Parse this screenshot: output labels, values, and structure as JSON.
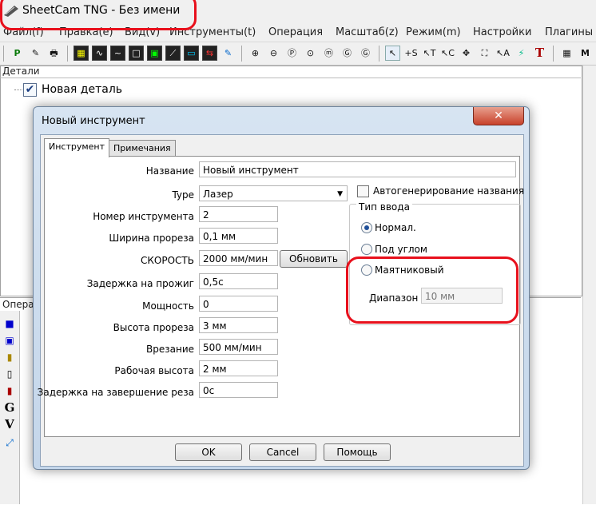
{
  "window": {
    "title": "SheetCam TNG - Без имени"
  },
  "menu": [
    "Файл(f)",
    "Правка(e)",
    "Вид(v)",
    "Инструменты(t)",
    "Операция",
    "Масштаб(z)",
    "Режим(m)",
    "Настройки",
    "Плагины"
  ],
  "toolbar": {
    "icons": [
      "P",
      "✎",
      "🖶",
      "▦",
      "∿",
      "~",
      "□",
      "▣",
      "⟋",
      "▭",
      "⇆",
      "✎",
      "⊕",
      "⊖",
      "Ⓟ",
      "⊙",
      "ⓜ",
      "Ⓖ",
      "↖",
      "+S",
      "↖T",
      "↖C",
      "✥",
      "⛶",
      "↖A",
      "⚡",
      "T",
      "▦",
      "M"
    ]
  },
  "panels": {
    "details": "Детали",
    "operations": "Опера",
    "tree_item": "Новая деталь"
  },
  "op_tools": [
    "■",
    "▣",
    "▮",
    "▯",
    "▮",
    "G",
    "V",
    "⤢"
  ],
  "dialog": {
    "title": "Новый инструмент",
    "close_icon": "✕",
    "tabs": [
      "Инструмент",
      "Примечания"
    ],
    "fields": {
      "name_label": "Название",
      "name_value": "Новый инструмент",
      "type_label": "Type",
      "type_value": "Лазер",
      "autogen_label": "Автогенерирование названия",
      "number_label": "Номер инструмента",
      "number_value": "2",
      "kerf_label": "Ширина прореза",
      "kerf_value": "0,1 мм",
      "speed_label": "СКОРОСТЬ",
      "speed_value": "2000 мм/мин",
      "update_label": "Обновить",
      "pierce_delay_label": "Задержка на прожиг",
      "pierce_delay_value": "0,5с",
      "power_label": "Мощность",
      "power_value": "0",
      "cut_height_label": "Высота прореза",
      "cut_height_value": "3 мм",
      "plunge_label": "Врезание",
      "plunge_value": "500 мм/мин",
      "work_height_label": "Рабочая высота",
      "work_height_value": "2 мм",
      "end_delay_label": "Задержка на завершение реза",
      "end_delay_value": "0с"
    },
    "entry": {
      "group_title": "Тип ввода",
      "normal": "Нормал.",
      "angle": "Под углом",
      "pendulum": "Маятниковый",
      "range_label": "Диапазон",
      "range_value": "10 мм"
    },
    "buttons": {
      "ok": "OK",
      "cancel": "Cancel",
      "help": "Помощь"
    }
  },
  "colors": {
    "annotation": "#e8101c"
  }
}
